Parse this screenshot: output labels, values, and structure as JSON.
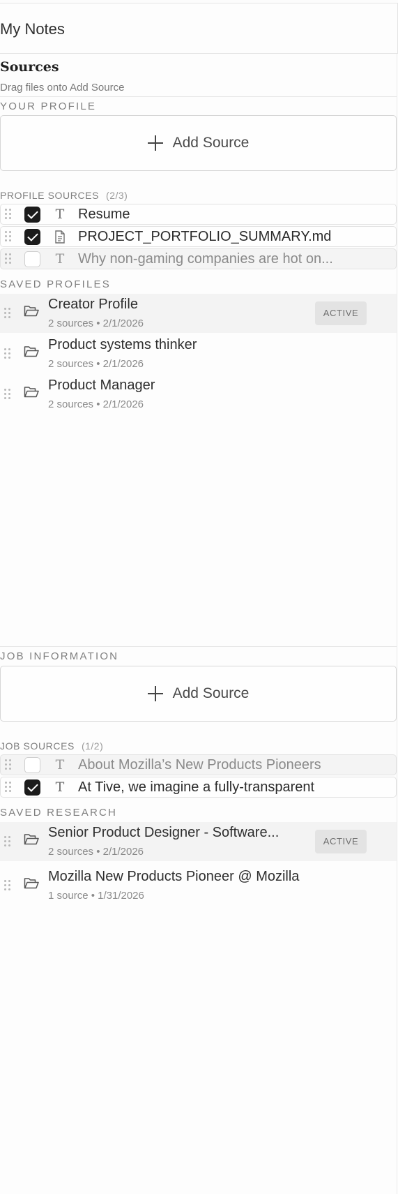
{
  "app_title": "My Notes",
  "sources": {
    "title": "Sources",
    "subtitle": "Drag files onto Add Source"
  },
  "profile": {
    "section_label": "YOUR PROFILE",
    "add_source_label": "Add Source",
    "sources_label": "PROFILE SOURCES",
    "sources_count": "(2/3)",
    "items": [
      {
        "label": "Resume",
        "checked": true,
        "icon": "text-icon"
      },
      {
        "label": "PROJECT_PORTFOLIO_SUMMARY.md",
        "checked": true,
        "icon": "document-icon"
      },
      {
        "label": "Why non-gaming companies are hot on...",
        "checked": false,
        "icon": "text-icon"
      }
    ],
    "saved_label": "SAVED PROFILES",
    "saved": [
      {
        "name": "Creator Profile",
        "meta": "2 sources • 2/1/2026",
        "active": true,
        "badge": "ACTIVE"
      },
      {
        "name": "Product systems thinker",
        "meta": "2 sources • 2/1/2026",
        "active": false
      },
      {
        "name": "Product Manager",
        "meta": "2 sources • 2/1/2026",
        "active": false
      }
    ]
  },
  "job": {
    "section_label": "JOB INFORMATION",
    "add_source_label": "Add Source",
    "sources_label": "JOB SOURCES",
    "sources_count": "(1/2)",
    "items": [
      {
        "label": "About Mozilla’s New Products Pioneers",
        "checked": false,
        "icon": "text-icon"
      },
      {
        "label": "At Tive, we imagine a fully-transparent",
        "checked": true,
        "icon": "text-icon"
      }
    ],
    "saved_label": "SAVED RESEARCH",
    "saved": [
      {
        "name": "Senior Product Designer - Software...",
        "meta": "2 sources • 2/1/2026",
        "active": true,
        "badge": "ACTIVE"
      },
      {
        "name": "Mozilla New Products Pioneer @ Mozilla",
        "meta": "1 source • 1/31/2026",
        "active": false
      }
    ]
  }
}
